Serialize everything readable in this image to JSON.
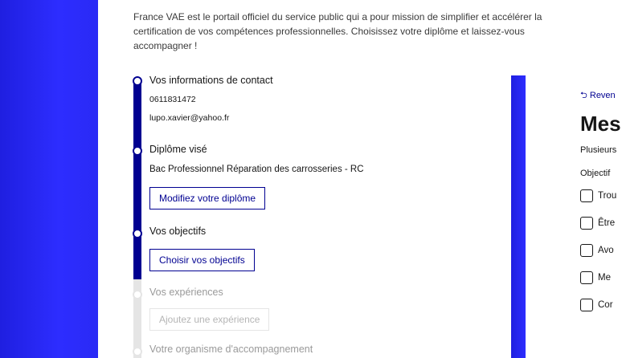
{
  "intro_text": "France VAE est le portail officiel du service public qui a pour mission de simplifier et accélérer la certification de vos compétences professionnelles. Choisissez votre diplôme et laissez-vous accompagner !",
  "steps": {
    "contact": {
      "title": "Vos informations de contact",
      "phone": "0611831472",
      "email": "lupo.xavier@yahoo.fr"
    },
    "diploma": {
      "title": "Diplôme visé",
      "value": "Bac Professionnel Réparation des carrosseries - RC",
      "button": "Modifiez votre diplôme"
    },
    "objectives": {
      "title": "Vos objectifs",
      "button": "Choisir vos objectifs"
    },
    "experiences": {
      "title": "Vos expériences",
      "button": "Ajoutez une expérience"
    },
    "organism": {
      "title": "Votre organisme d'accompagnement"
    }
  },
  "panel": {
    "back_link": "Reven",
    "back_icon": "undo-arrow-icon",
    "title": "Mes",
    "subtitle": "Plusieurs",
    "label": "Objectif",
    "options": [
      "Trou",
      "Être",
      "Avo",
      "Me",
      "Cor"
    ]
  },
  "colors": {
    "primary": "#000091",
    "band": "#2a2af5",
    "inactive": "#e5e5e5"
  }
}
